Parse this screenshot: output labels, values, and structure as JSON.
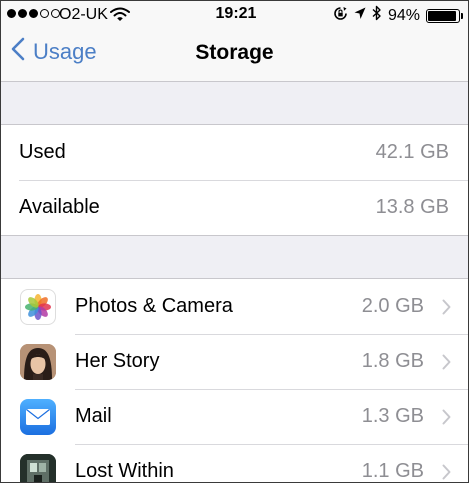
{
  "status_bar": {
    "carrier": "O2-UK",
    "time": "19:21",
    "battery": "94%",
    "battery_level": 0.94,
    "signal_bars_filled": 3,
    "signal_bars_total": 5
  },
  "nav": {
    "back_label": "Usage",
    "title": "Storage"
  },
  "summary": [
    {
      "label": "Used",
      "value": "42.1 GB"
    },
    {
      "label": "Available",
      "value": "13.8 GB"
    }
  ],
  "apps": [
    {
      "name": "Photos & Camera",
      "size": "2.0 GB",
      "icon": "photos-icon"
    },
    {
      "name": "Her Story",
      "size": "1.8 GB",
      "icon": "her-story-icon"
    },
    {
      "name": "Mail",
      "size": "1.3 GB",
      "icon": "mail-icon"
    },
    {
      "name": "Lost Within",
      "size": "1.1 GB",
      "icon": "lost-within-icon"
    }
  ],
  "colors": {
    "accent": "#4c7fc6",
    "secondary_text": "#8e8e93",
    "background": "#efeff4"
  }
}
